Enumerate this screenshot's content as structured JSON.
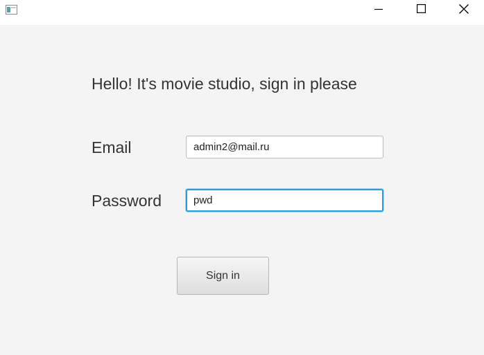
{
  "window": {
    "icon": "app-window-icon",
    "controls": {
      "minimize_icon": "minimize-icon",
      "maximize_icon": "maximize-icon",
      "close_icon": "close-icon"
    }
  },
  "form": {
    "heading": "Hello! It's movie studio, sign in please",
    "email_label": "Email",
    "email_value": "admin2@mail.ru",
    "password_label": "Password",
    "password_value": "pwd",
    "submit_label": "Sign in"
  },
  "colors": {
    "background": "#f4f4f4",
    "focus_border": "#2a9fd6"
  }
}
